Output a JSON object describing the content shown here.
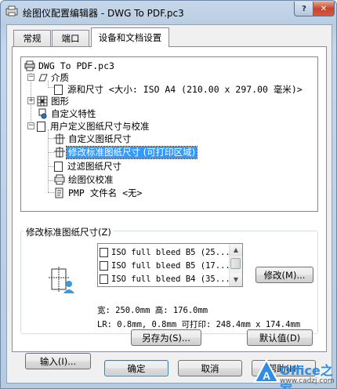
{
  "window": {
    "title": "绘图仪配置编辑器 - DWG To PDF.pc3",
    "help_glyph": "?",
    "close_glyph": "✕"
  },
  "tabs": [
    {
      "label": "常规",
      "active": false
    },
    {
      "label": "端口",
      "active": false
    },
    {
      "label": "设备和文档设置",
      "active": true
    }
  ],
  "tree": {
    "root": "DWG To PDF.pc3",
    "media": "介质",
    "source_size": "源和尺寸 <大小: ISO A4 (210.00 x 297.00 毫米)>",
    "graphics": "图形",
    "custom_properties": "自定义特性",
    "user_defined": "用户定义图纸尺寸与校准",
    "custom_paper_sizes": "自定义图纸尺寸",
    "modify_standard": "修改标准图纸尺寸 (可打印区域)",
    "filter_paper": "过滤图纸尺寸",
    "plotter_calibration": "绘图仪校准",
    "pmp_file": "PMP 文件名 <无>",
    "expand_minus": "−",
    "expand_plus": "+"
  },
  "modify_group": {
    "label": "修改标准图纸尺寸(Z)",
    "list": [
      "ISO full bleed B5 (25...",
      "ISO full bleed B5 (17...",
      "ISO full bleed B4 (35..."
    ],
    "modify_button": "修改(M)...",
    "size_line": "宽: 250.0mm 高: 176.0mm",
    "margins_line": "LR: 0.8mm, 0.8mm   可打印: 248.4mm x 174.4mm"
  },
  "buttons": {
    "import": "输入(I)...",
    "save_as": "另存为(S)...",
    "defaults": "默认值(D)",
    "ok": "确定",
    "cancel": "取消",
    "help": "帮助(H)"
  },
  "watermark": {
    "brand": "Office之家",
    "url": "www.cadzj.com"
  },
  "colors": {
    "selection": "#3399ff",
    "title_bg": "#c7d8ea",
    "close_red": "#c8442b"
  }
}
